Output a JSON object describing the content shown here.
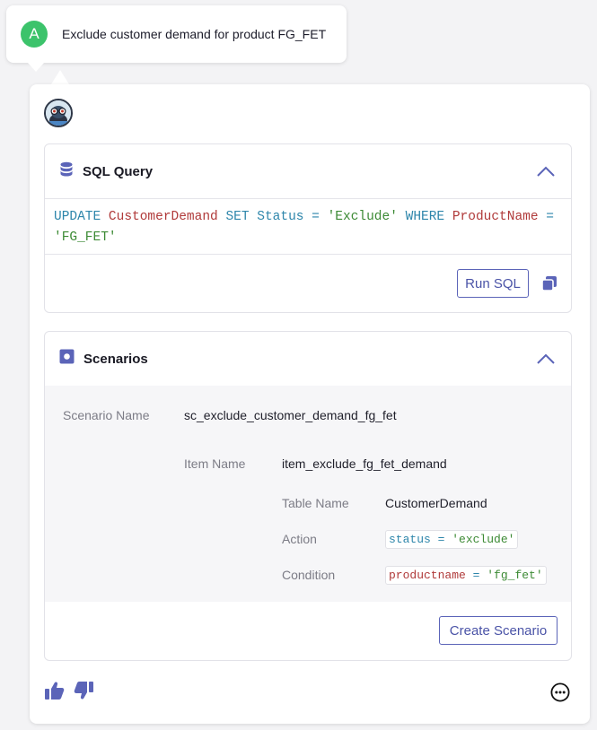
{
  "user_message": {
    "avatar_letter": "A",
    "text": "Exclude customer demand for product FG_FET"
  },
  "sql_panel": {
    "title": "SQL Query",
    "query_tokens": [
      {
        "text": "UPDATE",
        "kind": "kw"
      },
      {
        "text": " ",
        "kind": "sp"
      },
      {
        "text": "CustomerDemand",
        "kind": "tbl"
      },
      {
        "text": " ",
        "kind": "sp"
      },
      {
        "text": "SET",
        "kind": "kw"
      },
      {
        "text": " ",
        "kind": "sp"
      },
      {
        "text": "Status",
        "kind": "col"
      },
      {
        "text": " = ",
        "kind": "op"
      },
      {
        "text": "'Exclude'",
        "kind": "str"
      },
      {
        "text": " ",
        "kind": "sp"
      },
      {
        "text": "WHERE",
        "kind": "kw"
      },
      {
        "text": " ",
        "kind": "sp"
      },
      {
        "text": "ProductName",
        "kind": "tbl"
      },
      {
        "text": " = ",
        "kind": "op"
      },
      {
        "text": "'FG_FET'",
        "kind": "str"
      }
    ],
    "run_label": "Run SQL"
  },
  "scenarios_panel": {
    "title": "Scenarios",
    "scenario_name_label": "Scenario Name",
    "scenario_name": "sc_exclude_customer_demand_fg_fet",
    "item_name_label": "Item Name",
    "item_name": "item_exclude_fg_fet_demand",
    "table_name_label": "Table Name",
    "table_name": "CustomerDemand",
    "action_label": "Action",
    "action": {
      "left": "status",
      "op": " = ",
      "right": "'exclude'"
    },
    "condition_label": "Condition",
    "condition": {
      "left": "productname",
      "op": " = ",
      "right": "'fg_fet'"
    },
    "create_label": "Create Scenario"
  },
  "colors": {
    "accent": "#5b64b8",
    "user_avatar": "#3cc36b",
    "keyword": "#2e86ab",
    "table": "#b03a3a",
    "string": "#3c8a34"
  },
  "icons": [
    "database-icon",
    "chevron-up-icon",
    "copy-icon",
    "scenario-icon",
    "thumbs-up-icon",
    "thumbs-down-icon",
    "more-options-icon"
  ]
}
